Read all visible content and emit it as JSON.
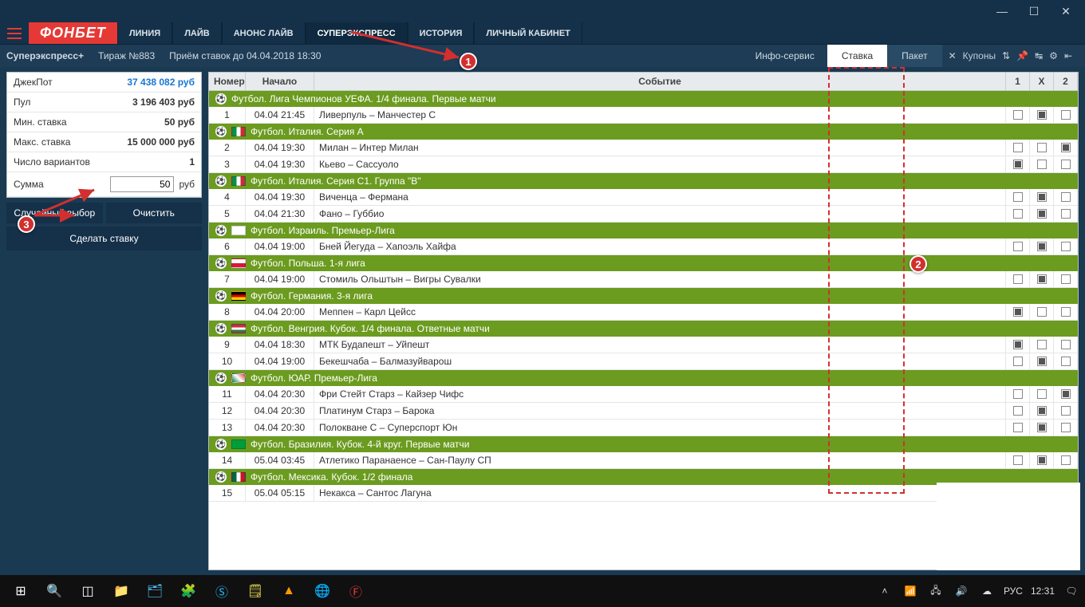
{
  "window": {
    "logo": "ФОНБЕТ"
  },
  "menu": [
    "ЛИНИЯ",
    "ЛАЙВ",
    "АНОНС ЛАЙВ",
    "СУПЕРЭКСПРЕСС",
    "ИСТОРИЯ",
    "ЛИЧНЫЙ КАБИНЕТ"
  ],
  "menu_active": 3,
  "subbar": {
    "title": "Суперэкспресс+",
    "edition": "Тираж №883",
    "deadline": "Приём ставок до 04.04.2018 18:30",
    "info": "Инфо-сервис",
    "tabs": [
      "Ставка",
      "Пакет"
    ],
    "tab_active": 0,
    "coupons": "Купоны"
  },
  "sidebar": {
    "rows": [
      {
        "k": "ДжекПот",
        "v": "37 438 082 руб",
        "blue": true
      },
      {
        "k": "Пул",
        "v": "3 196 403 руб",
        "bold": true
      },
      {
        "k": "Мин. ставка",
        "v": "50 руб",
        "bold": true
      },
      {
        "k": "Макс. ставка",
        "v": "15 000 000 руб",
        "bold": true
      },
      {
        "k": "Число вариантов",
        "v": "1",
        "bold": true
      }
    ],
    "amount_label": "Сумма",
    "amount_value": "50",
    "amount_unit": "руб",
    "random": "Случайный выбор",
    "clear": "Очистить",
    "submit": "Сделать ставку"
  },
  "table": {
    "head": {
      "n": "Номер",
      "t": "Начало",
      "e": "Событие",
      "c1": "1",
      "cx": "X",
      "c2": "2"
    },
    "groups": [
      {
        "flag": "",
        "title": "Футбол. Лига Чемпионов УЕФА. 1/4 финала. Первые матчи",
        "rows": [
          {
            "n": "1",
            "t": "04.04  21:45",
            "e": "Ливерпуль – Манчестер С",
            "s": [
              0,
              1,
              0
            ]
          }
        ]
      },
      {
        "flag": "it",
        "title": "Футбол. Италия. Серия А",
        "rows": [
          {
            "n": "2",
            "t": "04.04  19:30",
            "e": "Милан – Интер Милан",
            "s": [
              0,
              0,
              1
            ]
          },
          {
            "n": "3",
            "t": "04.04  19:30",
            "e": "Кьево – Сассуоло",
            "s": [
              1,
              0,
              0
            ]
          }
        ]
      },
      {
        "flag": "it",
        "title": "Футбол. Италия. Серия С1. Группа \"B\"",
        "rows": [
          {
            "n": "4",
            "t": "04.04  19:30",
            "e": "Виченца – Фермана",
            "s": [
              0,
              1,
              0
            ]
          },
          {
            "n": "5",
            "t": "04.04  21:30",
            "e": "Фано – Губбио",
            "s": [
              0,
              1,
              0
            ]
          }
        ]
      },
      {
        "flag": "il",
        "title": "Футбол. Израиль. Премьер-Лига",
        "rows": [
          {
            "n": "6",
            "t": "04.04  19:00",
            "e": "Бней Йегуда – Хапоэль Хайфа",
            "s": [
              0,
              1,
              0
            ]
          }
        ]
      },
      {
        "flag": "pl",
        "title": "Футбол. Польша. 1-я лига",
        "rows": [
          {
            "n": "7",
            "t": "04.04  19:00",
            "e": "Стомиль Ольштын – Вигры Сувалки",
            "s": [
              0,
              1,
              0
            ]
          }
        ]
      },
      {
        "flag": "de",
        "title": "Футбол. Германия. 3-я лига",
        "rows": [
          {
            "n": "8",
            "t": "04.04  20:00",
            "e": "Меппен – Карл Цейсс",
            "s": [
              1,
              0,
              0
            ]
          }
        ]
      },
      {
        "flag": "hu",
        "title": "Футбол. Венгрия. Кубок. 1/4 финала. Ответные матчи",
        "rows": [
          {
            "n": "9",
            "t": "04.04  18:30",
            "e": "МТК Будапешт – Уйпешт",
            "s": [
              1,
              0,
              0
            ]
          },
          {
            "n": "10",
            "t": "04.04  19:00",
            "e": "Бекешчаба – Балмазуйварош",
            "s": [
              0,
              1,
              0
            ]
          }
        ]
      },
      {
        "flag": "za",
        "title": "Футбол. ЮАР. Премьер-Лига",
        "rows": [
          {
            "n": "11",
            "t": "04.04  20:30",
            "e": "Фри Стейт Старз – Кайзер Чифс",
            "s": [
              0,
              0,
              1
            ]
          },
          {
            "n": "12",
            "t": "04.04  20:30",
            "e": "Платинум Старз – Барока",
            "s": [
              0,
              1,
              0
            ]
          },
          {
            "n": "13",
            "t": "04.04  20:30",
            "e": "Полокване С – Суперспорт Юн",
            "s": [
              0,
              1,
              0
            ]
          }
        ]
      },
      {
        "flag": "br",
        "title": "Футбол. Бразилия. Кубок. 4-й круг. Первые матчи",
        "rows": [
          {
            "n": "14",
            "t": "05.04  03:45",
            "e": "Атлетико Паранаенсе – Сан-Паулу СП",
            "s": [
              0,
              1,
              0
            ]
          }
        ]
      },
      {
        "flag": "mx",
        "title": "Футбол. Мексика. Кубок. 1/2 финала",
        "rows": [
          {
            "n": "15",
            "t": "05.04  05:15",
            "e": "Некакса – Сантос Лагуна",
            "s": [
              1,
              0,
              0
            ]
          }
        ]
      }
    ]
  },
  "annotations": {
    "b1": "1",
    "b2": "2",
    "b3": "3"
  },
  "taskbar": {
    "lang": "РУС",
    "time": "12:31"
  },
  "flags": {
    "it": "linear-gradient(90deg,#009246 33%,#fff 33%,#fff 66%,#ce2b37 66%)",
    "il": "linear-gradient(#fff,#fff)",
    "pl": "linear-gradient(#fff 50%,#dc143c 50%)",
    "de": "linear-gradient(#000 33%,#dd0000 33%,#dd0000 66%,#ffce00 66%)",
    "hu": "linear-gradient(#cd2a3e 33%,#fff 33%,#fff 66%,#436f4d 66%)",
    "za": "linear-gradient(45deg,#007749,#fff,#de3831)",
    "br": "linear-gradient(#009c3b,#009c3b)",
    "mx": "linear-gradient(90deg,#006847 33%,#fff 33%,#fff 66%,#ce1126 66%)"
  }
}
